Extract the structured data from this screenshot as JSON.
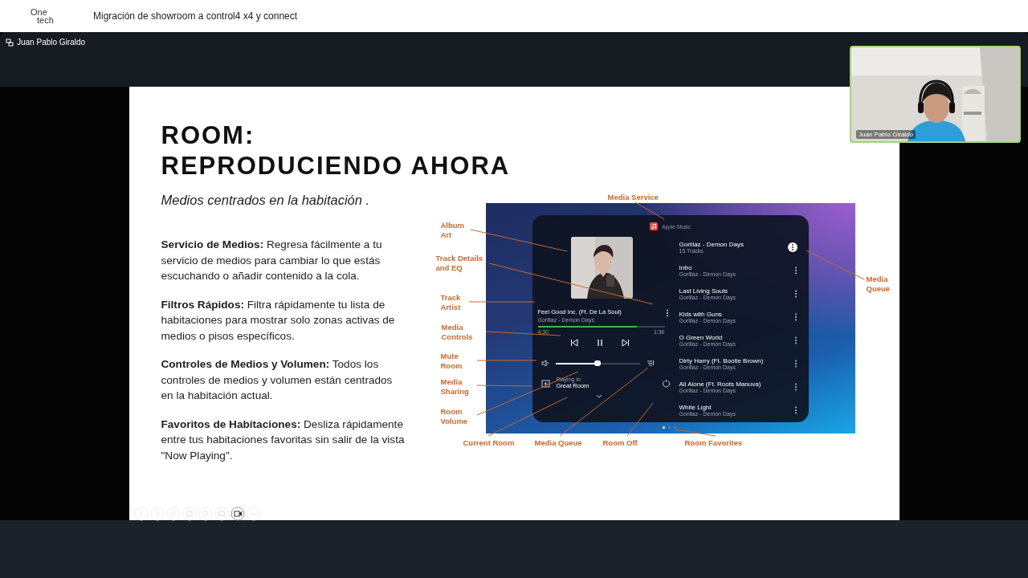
{
  "app_bar": {
    "logo_lines": [
      "One",
      "tech"
    ],
    "title": "Migración de showroom a control4 x4 y connect"
  },
  "presenter_bar": {
    "name": "Juan Pablo Giraldo"
  },
  "slide": {
    "title_lines": [
      "ROOM:",
      "REPRODUCIENDO AHORA"
    ],
    "subtitle": "Medios centrados en la habitación .",
    "points": [
      {
        "text": "**Servicio de Medios:** Regresa fácilmente a tu servicio de medios para cambiar lo que estás escuchando o añadir contenido a la cola."
      },
      {
        "text": "**Filtros Rápidos:** Filtra rápidamente tu lista de habitaciones para mostrar solo zonas activas de medios o pisos específicos."
      },
      {
        "text": "**Controles de Medios y Volumen:** Todos los controles de medios y volumen están centrados en la habitación actual."
      },
      {
        "text": "**Favoritos de Habitaciones:** Desliza rápidamente entre tus habitaciones favoritas sin salir de la vista \"Now Playing\"."
      }
    ],
    "figure": {
      "callouts": [
        "Media Service",
        "Album Art",
        "Track Details and EQ",
        "Track Artist",
        "Media Controls",
        "Mute Room",
        "Media Sharing",
        "Room Volume",
        "Current Room",
        "Media Queue",
        "Room Off",
        "Room Favorites",
        "Media Queue"
      ],
      "player": {
        "service": "Apple Music",
        "track": "Feel Good Inc. (Ft. De La Soul)",
        "artist": "Gorillaz - Demon Days",
        "progress": {
          "level": 0.78
        },
        "elapsed": "4:30",
        "remaining": "1:30",
        "volume": {
          "level": 0.5
        },
        "playing_in": "Playing in",
        "room": "Great Room",
        "album": {
          "title": "Gorillaz - Demon Days",
          "count": "15 Tracks"
        },
        "tracks": [
          {
            "title": "Intro",
            "artist": "Gorillaz - Demon Days"
          },
          {
            "title": "Last Living Souls",
            "artist": "Gorillaz - Demon Days"
          },
          {
            "title": "Kids with Guns",
            "artist": "Gorillaz - Demon Days"
          },
          {
            "title": "O Green World",
            "artist": "Gorillaz - Demon Days"
          },
          {
            "title": "Dirty Harry (Ft. Bootie Brown)",
            "artist": "Gorillaz - Demon Days"
          },
          {
            "title": "All Alone (Ft. Roots Manuva)",
            "artist": "Gorillaz - Demon Days"
          },
          {
            "title": "White Light",
            "artist": "Gorillaz - Demon Days"
          }
        ],
        "pages": [
          {
            "selected": true
          },
          {
            "selected": false
          },
          {
            "selected": false
          }
        ]
      }
    }
  },
  "webcam": {
    "name": "Juan Pablo Giraldo"
  }
}
